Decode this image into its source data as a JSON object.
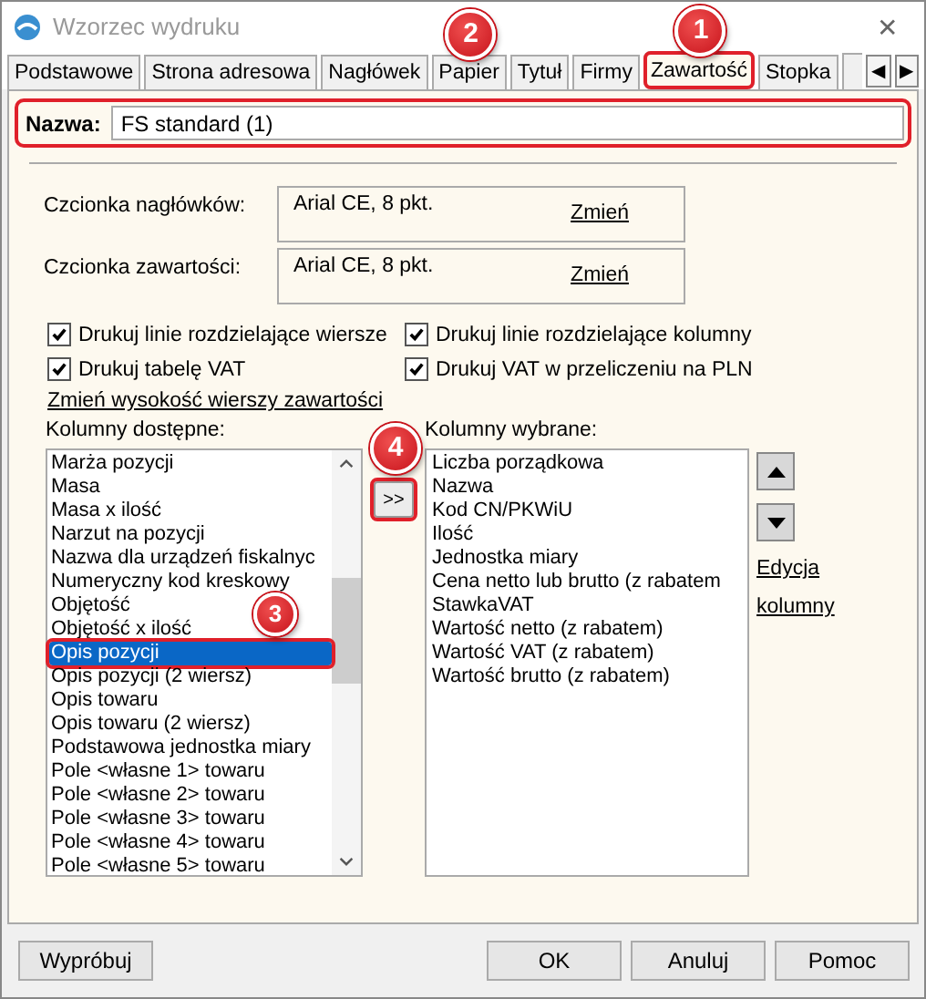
{
  "window": {
    "title": "Wzorzec wydruku",
    "close": "✕"
  },
  "tabs": [
    {
      "label": "Podstawowe",
      "selected": false,
      "highlighted": false
    },
    {
      "label": "Strona adresowa",
      "selected": false,
      "highlighted": false
    },
    {
      "label": "Nagłówek",
      "selected": false,
      "highlighted": false
    },
    {
      "label": "Papier",
      "selected": false,
      "highlighted": false,
      "callout": "2"
    },
    {
      "label": "Tytuł",
      "selected": false,
      "highlighted": false
    },
    {
      "label": "Firmy",
      "selected": false,
      "highlighted": false
    },
    {
      "label": "Zawartość",
      "selected": true,
      "highlighted": true,
      "callout": "1"
    },
    {
      "label": "Stopka",
      "selected": false,
      "highlighted": false
    }
  ],
  "tab_scroll": [
    "◀",
    "▶"
  ],
  "name_field": {
    "label": "Nazwa:",
    "value": "FS standard (1)",
    "highlighted": true
  },
  "fonts": [
    {
      "label": "Czcionka nagłówków:",
      "value": "Arial CE, 8 pkt.",
      "link": "Zmień"
    },
    {
      "label": "Czcionka zawartości:",
      "value": "Arial CE, 8 pkt.",
      "link": "Zmień"
    }
  ],
  "checkboxes": [
    {
      "label": "Drukuj linie rozdzielające wiersze",
      "checked": true
    },
    {
      "label": "Drukuj linie rozdzielające kolumny",
      "checked": true
    },
    {
      "label": "Drukuj tabelę VAT",
      "checked": true
    },
    {
      "label": "Drukuj VAT w przeliczeniu na PLN",
      "checked": true
    }
  ],
  "row_height_link": "Zmień wysokość wierszy zawartości",
  "available": {
    "label": "Kolumny dostępne:",
    "items": [
      {
        "label": "Marża pozycji",
        "selected": false,
        "highlighted": false
      },
      {
        "label": "Masa",
        "selected": false,
        "highlighted": false
      },
      {
        "label": "Masa x ilość",
        "selected": false,
        "highlighted": false
      },
      {
        "label": "Narzut na pozycji",
        "selected": false,
        "highlighted": false
      },
      {
        "label": "Nazwa dla urządzeń fiskalnyc",
        "selected": false,
        "highlighted": false
      },
      {
        "label": "Numeryczny kod kreskowy",
        "selected": false,
        "highlighted": false
      },
      {
        "label": "Objętość",
        "selected": false,
        "highlighted": false
      },
      {
        "label": "Objętość x ilość",
        "selected": false,
        "highlighted": false
      },
      {
        "label": "Opis pozycji",
        "selected": true,
        "highlighted": true,
        "callout": "3"
      },
      {
        "label": "Opis pozycji (2 wiersz)",
        "selected": false,
        "highlighted": false
      },
      {
        "label": "Opis towaru",
        "selected": false,
        "highlighted": false
      },
      {
        "label": "Opis towaru (2 wiersz)",
        "selected": false,
        "highlighted": false
      },
      {
        "label": "Podstawowa jednostka miary",
        "selected": false,
        "highlighted": false
      },
      {
        "label": "Pole <własne 1> towaru",
        "selected": false,
        "highlighted": false
      },
      {
        "label": "Pole <własne 2> towaru",
        "selected": false,
        "highlighted": false
      },
      {
        "label": "Pole <własne 3> towaru",
        "selected": false,
        "highlighted": false
      },
      {
        "label": "Pole <własne 4> towaru",
        "selected": false,
        "highlighted": false
      },
      {
        "label": "Pole <własne 5> towaru",
        "selected": false,
        "highlighted": false
      }
    ]
  },
  "add_button": {
    "label": ">>",
    "highlighted": true,
    "callout": "4"
  },
  "chosen": {
    "label": "Kolumny wybrane:",
    "items": [
      "Liczba porządkowa",
      "Nazwa",
      "Kod CN/PKWiU",
      "Ilość",
      "Jednostka miary",
      "Cena netto lub brutto (z rabatem",
      "StawkaVAT",
      "Wartość netto (z rabatem)",
      "Wartość VAT (z rabatem)",
      "Wartość brutto (z rabatem)"
    ]
  },
  "edit_links": [
    "Edycja",
    "kolumny"
  ],
  "buttons": {
    "left": [
      "Wypróbuj"
    ],
    "right": [
      "OK",
      "Anuluj",
      "Pomoc"
    ]
  }
}
